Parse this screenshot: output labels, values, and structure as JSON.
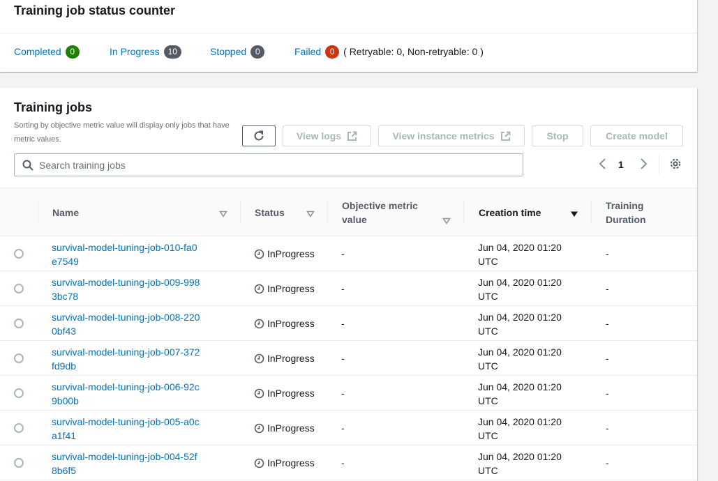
{
  "status_counter": {
    "title": "Training job status counter",
    "completed": {
      "label": "Completed",
      "count": "0"
    },
    "in_progress": {
      "label": "In Progress",
      "count": "10"
    },
    "stopped": {
      "label": "Stopped",
      "count": "0"
    },
    "failed": {
      "label": "Failed",
      "count": "0",
      "detail": "( Retryable: 0, Non-retryable: 0 )"
    }
  },
  "training_jobs": {
    "title": "Training jobs",
    "description": "Sorting by objective metric value will display only jobs that have metric values.",
    "buttons": {
      "view_logs": "View logs",
      "view_instance_metrics": "View instance metrics",
      "stop": "Stop",
      "create_model": "Create model"
    },
    "search": {
      "placeholder": "Search training jobs",
      "value": ""
    },
    "pagination": {
      "current_page": "1"
    },
    "columns": {
      "name": "Name",
      "status": "Status",
      "objective_metric": "Objective metric value",
      "creation_time": "Creation time",
      "training_duration": "Training Duration"
    },
    "rows": [
      {
        "name": "survival-model-tuning-job-010-fa0e7549",
        "status": "InProgress",
        "metric": "-",
        "created": "Jun 04, 2020 01:20 UTC",
        "duration": "-"
      },
      {
        "name": "survival-model-tuning-job-009-9983bc78",
        "status": "InProgress",
        "metric": "-",
        "created": "Jun 04, 2020 01:20 UTC",
        "duration": "-"
      },
      {
        "name": "survival-model-tuning-job-008-2200bf43",
        "status": "InProgress",
        "metric": "-",
        "created": "Jun 04, 2020 01:20 UTC",
        "duration": "-"
      },
      {
        "name": "survival-model-tuning-job-007-372fd9db",
        "status": "InProgress",
        "metric": "-",
        "created": "Jun 04, 2020 01:20 UTC",
        "duration": "-"
      },
      {
        "name": "survival-model-tuning-job-006-92c9b00b",
        "status": "InProgress",
        "metric": "-",
        "created": "Jun 04, 2020 01:20 UTC",
        "duration": "-"
      },
      {
        "name": "survival-model-tuning-job-005-a0ca1f41",
        "status": "InProgress",
        "metric": "-",
        "created": "Jun 04, 2020 01:20 UTC",
        "duration": "-"
      },
      {
        "name": "survival-model-tuning-job-004-52f8b6f5",
        "status": "InProgress",
        "metric": "-",
        "created": "Jun 04, 2020 01:20 UTC",
        "duration": "-"
      }
    ]
  },
  "colors": {
    "link": "#0073bb",
    "badge_completed": "#1d8102",
    "badge_neutral": "#545b64",
    "badge_failed": "#d13212"
  },
  "icons": {
    "refresh": "refresh-icon",
    "external": "external-link-icon",
    "search": "search-icon",
    "prev": "chevron-left-icon",
    "next": "chevron-right-icon",
    "settings": "gear-icon",
    "filter": "caret-down-outline-icon",
    "sort": "caret-down-filled-icon",
    "status": "clock-icon"
  }
}
